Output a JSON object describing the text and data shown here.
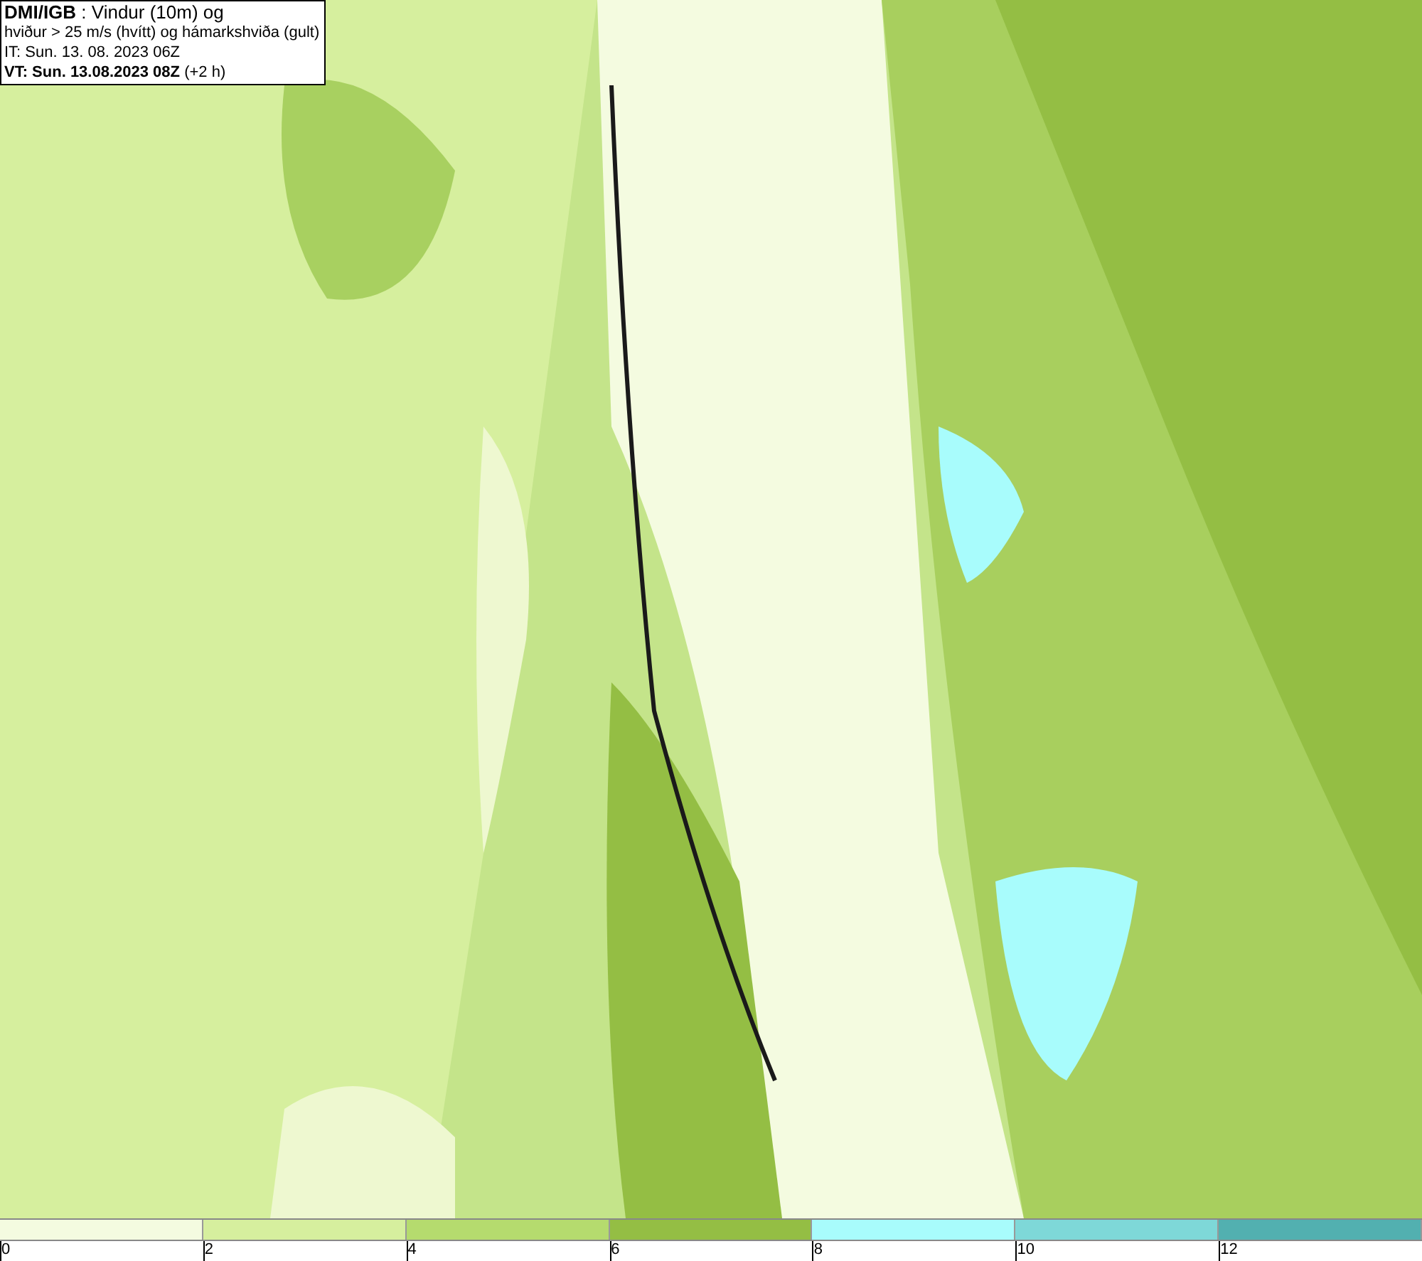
{
  "title_box": {
    "lines": [
      "**DMI/IGB** : Vindur (10m) og",
      "hviður > 25 m/s (hvítt) og hámarkshviða (gult)",
      "IT: Sun. 13. 08. 2023 06Z",
      "**VT: Sun. 13.08.2023 08Z** (+2 h)"
    ]
  },
  "legend": {
    "bins": [
      {
        "color": "#f4fbe0"
      },
      {
        "color": "#d6ef9e"
      },
      {
        "color": "#b5db6e"
      },
      {
        "color": "#94be44"
      },
      {
        "color": "#a8fcfc"
      },
      {
        "color": "#7ed8d8"
      },
      {
        "color": "#52b0b0"
      }
    ],
    "ticks": [
      "0",
      "2",
      "4",
      "6",
      "8",
      "10",
      "12"
    ]
  }
}
